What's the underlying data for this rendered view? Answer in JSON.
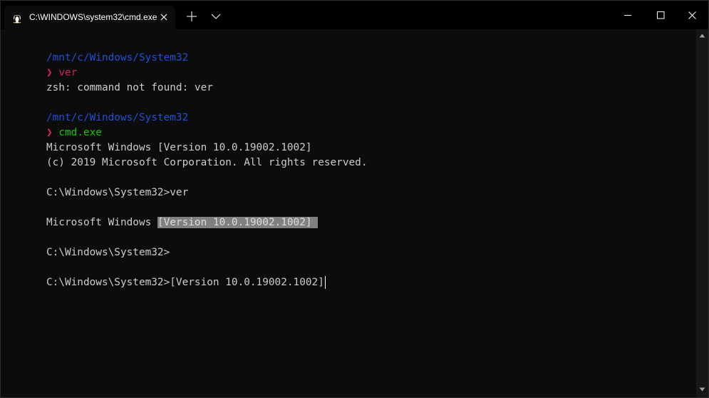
{
  "tab": {
    "title": "C:\\WINDOWS\\system32\\cmd.exe",
    "icon": "linux-tux-icon"
  },
  "titlebar": {
    "new_tab_icon": "plus-icon",
    "dropdown_icon": "chevron-down-icon",
    "minimize_icon": "minimize-icon",
    "maximize_icon": "maximize-icon",
    "close_icon": "close-icon"
  },
  "terminal": {
    "lines": [
      {
        "path": "/mnt/c/Windows/System32"
      },
      {
        "chev": "❯",
        "cmd": "ver"
      },
      {
        "text": "zsh: command not found: ver"
      },
      {
        "path": "/mnt/c/Windows/System32"
      },
      {
        "chev": "❯",
        "cmd": "cmd.exe"
      },
      {
        "text": "Microsoft Windows [Version 10.0.19002.1002]"
      },
      {
        "text": "(c) 2019 Microsoft Corporation. All rights reserved."
      },
      {
        "text": "C:\\Windows\\System32>ver"
      },
      {
        "text_before": "Microsoft Windows ",
        "selected": "[Version 10.0.19002.1002] "
      },
      {
        "text": "C:\\Windows\\System32>"
      },
      {
        "text": "C:\\Windows\\System32>[Version 10.0.19002.1002]"
      }
    ]
  },
  "colors": {
    "background": "#0c0c0c",
    "foreground": "#cccccc",
    "path": "#1f4fd6",
    "prompt": "#d8275d",
    "cmd_green": "#16c60c",
    "selection": "#808080"
  }
}
